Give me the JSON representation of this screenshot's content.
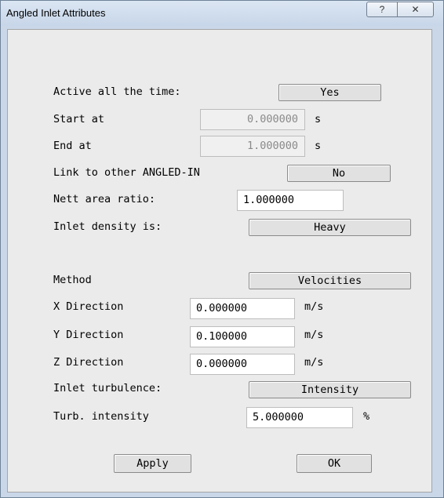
{
  "window": {
    "title": "Angled Inlet Attributes",
    "help_glyph": "?",
    "close_glyph": "✕"
  },
  "active": {
    "label": "Active all the time:",
    "button": "Yes"
  },
  "start": {
    "label": "Start at",
    "value": "0.000000",
    "unit": "s"
  },
  "end": {
    "label": "End at",
    "value": "1.000000",
    "unit": "s"
  },
  "link": {
    "label": "Link to other ANGLED-IN",
    "button": "No"
  },
  "nett": {
    "label": "Nett area ratio:",
    "value": "1.000000"
  },
  "density": {
    "label": "Inlet density is:",
    "button": "Heavy"
  },
  "method": {
    "label": "Method",
    "button": "Velocities"
  },
  "x_dir": {
    "label": "X Direction",
    "value": "0.000000",
    "unit": "m/s"
  },
  "y_dir": {
    "label": "Y Direction",
    "value": "0.100000",
    "unit": "m/s"
  },
  "z_dir": {
    "label": "Z Direction",
    "value": "0.000000",
    "unit": "m/s"
  },
  "turbulence": {
    "label": "Inlet turbulence:",
    "button": "Intensity"
  },
  "intensity": {
    "label": "Turb. intensity",
    "value": "5.000000",
    "unit": "%"
  },
  "actions": {
    "apply": "Apply",
    "ok": "OK"
  }
}
